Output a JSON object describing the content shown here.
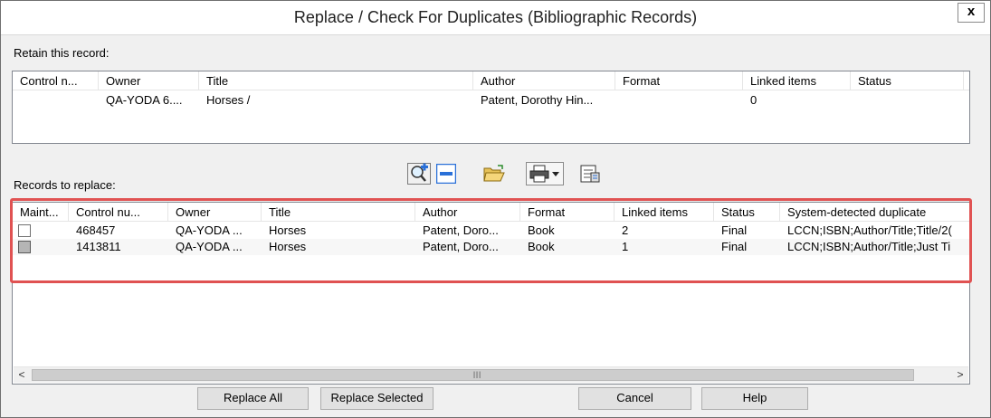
{
  "window": {
    "title": "Replace / Check For Duplicates (Bibliographic Records)",
    "close_label": "x"
  },
  "retain": {
    "label": "Retain this record:",
    "columns": [
      "Control n...",
      "Owner",
      "Title",
      "Author",
      "Format",
      "Linked items",
      "Status"
    ],
    "rows": [
      [
        "",
        "QA-YODA 6....",
        "Horses /",
        "Patent, Dorothy Hin...",
        "",
        "0",
        ""
      ]
    ]
  },
  "replace": {
    "label": "Records to replace:",
    "columns": [
      "Maint...",
      "Control nu...",
      "Owner",
      "Title",
      "Author",
      "Format",
      "Linked items",
      "Status",
      "System-detected duplicate"
    ],
    "rows": [
      {
        "checked": false,
        "control": "468457",
        "owner": "QA-YODA ...",
        "title": "Horses",
        "author": "Patent, Doro...",
        "format": "Book",
        "linked": "2",
        "status": "Final",
        "dup": "LCCN;ISBN;Author/Title;Title/2("
      },
      {
        "checked": true,
        "control": "1413811",
        "owner": "QA-YODA ...",
        "title": "Horses",
        "author": "Patent, Doro...",
        "format": "Book",
        "linked": "1",
        "status": "Final",
        "dup": "LCCN;ISBN;Author/Title;Just Ti"
      }
    ],
    "scroll_left": "<",
    "scroll_right": ">",
    "scroll_grip": "III"
  },
  "toolbar": {
    "icons": [
      "search-add-icon",
      "remove-icon",
      "open-folder-icon",
      "print-icon",
      "dropdown-arrow-icon",
      "properties-icon"
    ]
  },
  "buttons": {
    "replace_all": "Replace All",
    "replace_selected": "Replace Selected",
    "cancel": "Cancel",
    "help": "Help"
  },
  "colors": {
    "highlight_border": "#e05252",
    "window_bg": "#f0f0f0"
  }
}
